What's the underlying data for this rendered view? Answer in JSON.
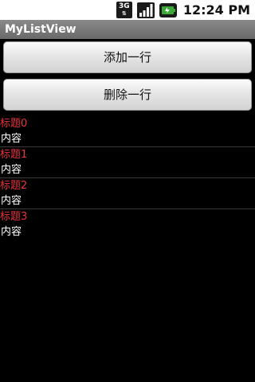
{
  "status_bar": {
    "network_label": "3G",
    "network_arrows": "⇅",
    "time": "12:24 PM",
    "icons": [
      "network-3g-icon",
      "signal-icon",
      "battery-icon"
    ]
  },
  "app": {
    "title": "MyListView"
  },
  "buttons": {
    "add_label": "添加一行",
    "delete_label": "删除一行"
  },
  "list": {
    "items": [
      {
        "title": "标题0",
        "content": "内容"
      },
      {
        "title": "标题1",
        "content": "内容"
      },
      {
        "title": "标题2",
        "content": "内容"
      },
      {
        "title": "标题3",
        "content": "内容"
      }
    ]
  },
  "colors": {
    "background": "#000000",
    "title_text": "#e8323c",
    "content_text": "#ffffff",
    "battery": "#3aa935"
  }
}
